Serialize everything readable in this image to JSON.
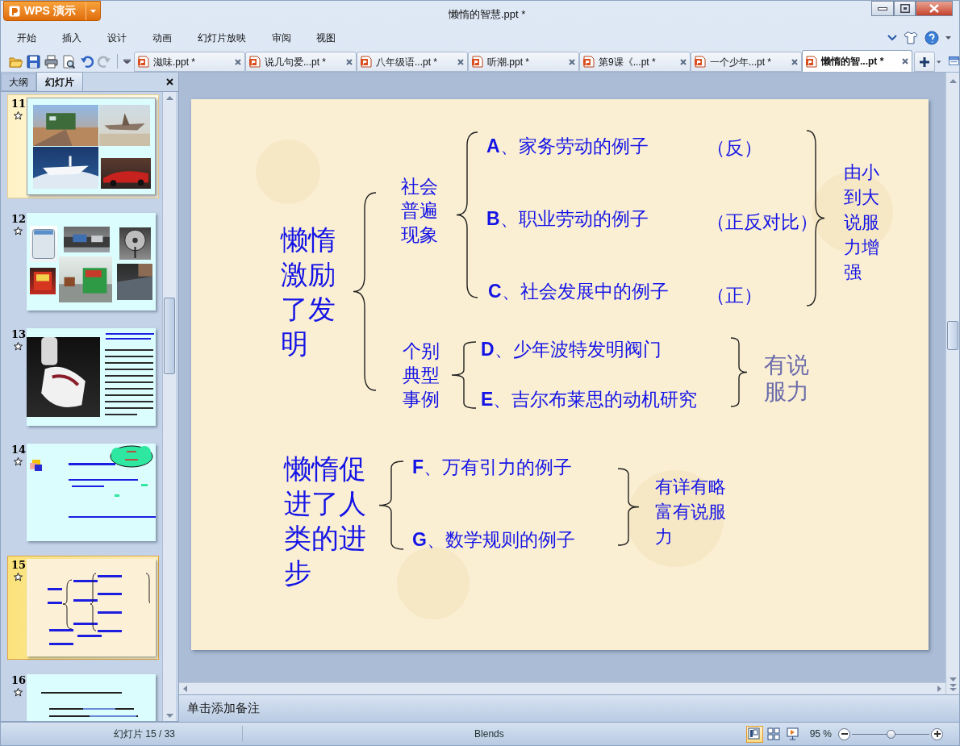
{
  "window": {
    "app_button": "WPS 演示",
    "title": "懒惰的智慧.ppt *"
  },
  "menu": [
    "开始",
    "插入",
    "设计",
    "动画",
    "幻灯片放映",
    "审阅",
    "视图"
  ],
  "doc_tabs": [
    {
      "label": "滋味.ppt *",
      "selected": false
    },
    {
      "label": "说几句爱...pt *",
      "selected": false
    },
    {
      "label": "八年级语...pt *",
      "selected": false
    },
    {
      "label": "听潮.ppt *",
      "selected": false
    },
    {
      "label": "第9课《...pt *",
      "selected": false
    },
    {
      "label": "一个少年...pt *",
      "selected": false
    },
    {
      "label": "懒惰的智...pt *",
      "selected": true
    }
  ],
  "panel_tabs": [
    {
      "label": "大纲",
      "selected": false
    },
    {
      "label": "幻灯片",
      "selected": true
    }
  ],
  "thumbnails": [
    {
      "number": "11",
      "selected": false,
      "hovered": true,
      "kind": "collage"
    },
    {
      "number": "12",
      "selected": false,
      "hovered": false,
      "kind": "collage"
    },
    {
      "number": "13",
      "selected": false,
      "hovered": false,
      "kind": "photo_text"
    },
    {
      "number": "14",
      "selected": false,
      "hovered": false,
      "kind": "bullets"
    },
    {
      "number": "15",
      "selected": true,
      "hovered": false,
      "kind": "diagram"
    },
    {
      "number": "16",
      "selected": false,
      "hovered": false,
      "kind": "text"
    }
  ],
  "slide": {
    "labels": [
      {
        "kind": "heading",
        "text": "懒惰激励了发明"
      },
      {
        "kind": "group",
        "text": "社会普遍现象"
      },
      {
        "kind": "item",
        "text": "**A**、家务劳动的例子"
      },
      {
        "kind": "tag",
        "text": "（反）"
      },
      {
        "kind": "item",
        "text": "**B**、职业劳动的例子"
      },
      {
        "kind": "tag",
        "text": "（正反对比）"
      },
      {
        "kind": "item",
        "text": "**C**、社会发展中的例子"
      },
      {
        "kind": "tag",
        "text": "（正）"
      },
      {
        "kind": "remark",
        "text": "由小到大说服力增强"
      },
      {
        "kind": "group",
        "text": "个别典型事例"
      },
      {
        "kind": "item",
        "text": "**D**、少年波特发明阀门"
      },
      {
        "kind": "item",
        "text": "**E**、吉尔布莱思的动机研究"
      },
      {
        "kind": "note",
        "text": "有说服力"
      },
      {
        "kind": "heading",
        "text": "懒惰促进了人类的进步"
      },
      {
        "kind": "item",
        "text": "**F**、万有引力的例子"
      },
      {
        "kind": "item",
        "text": "**G**、数学规则的例子"
      },
      {
        "kind": "remark",
        "text": "有详有略富有说服力"
      }
    ]
  },
  "notes": {
    "placeholder": "单击添加备注"
  },
  "status_bar": {
    "slide_count": "幻灯片 15 / 33",
    "theme": "Blends",
    "views": [
      {
        "kind": "normal",
        "selected": true
      },
      {
        "kind": "sorter",
        "selected": false
      },
      {
        "kind": "show",
        "selected": false
      }
    ],
    "zoom": "95 %",
    "zoom_slider": {
      "level": 0.5
    }
  }
}
